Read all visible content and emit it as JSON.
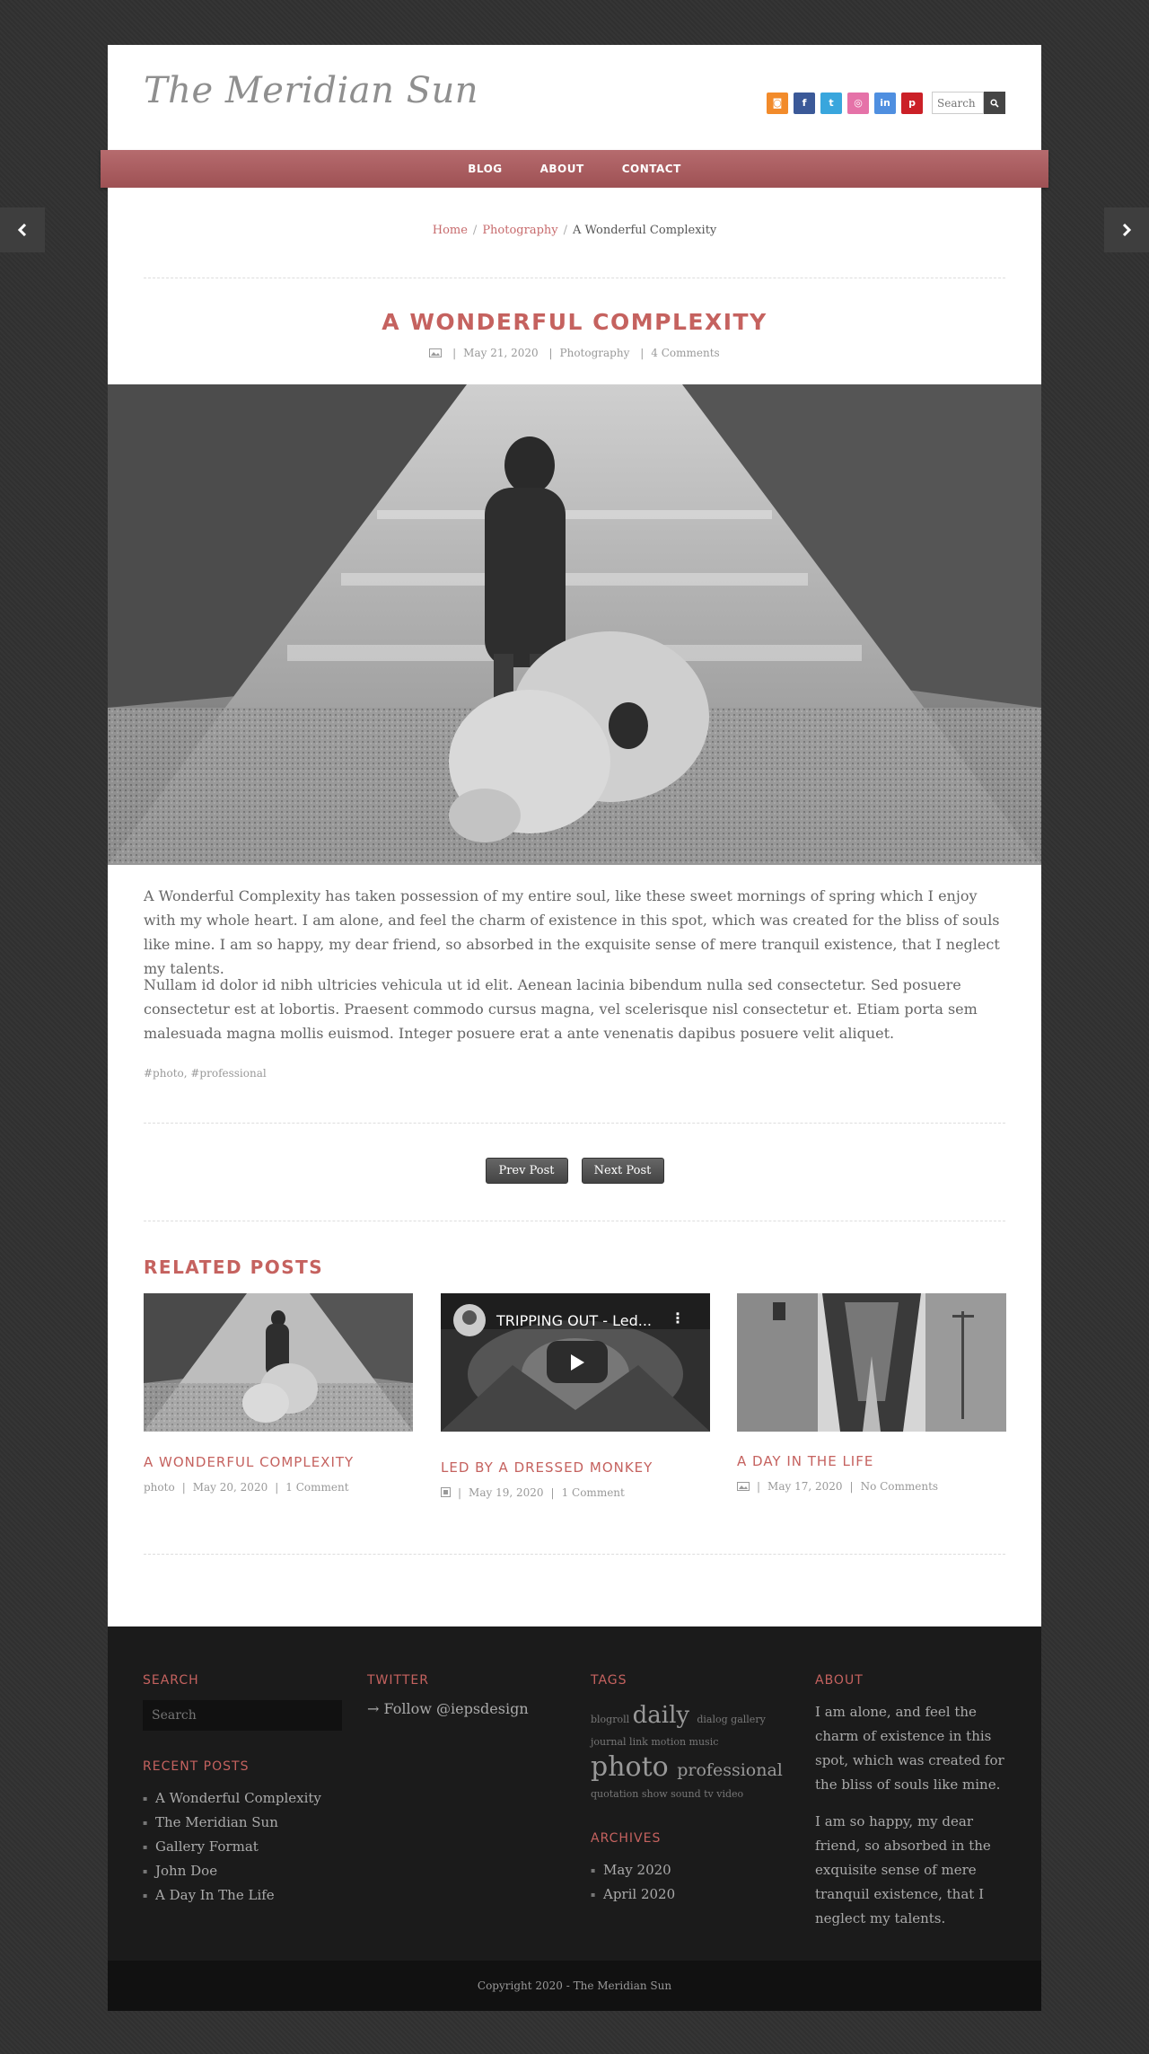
{
  "site": {
    "title": "The Meridian Sun",
    "search_placeholder": "Search"
  },
  "social": [
    {
      "name": "rss",
      "glyph": "◙",
      "color": "#f28b2b"
    },
    {
      "name": "facebook",
      "glyph": "f",
      "color": "#3b5998"
    },
    {
      "name": "twitter",
      "glyph": "t",
      "color": "#39a6dd"
    },
    {
      "name": "dribbble",
      "glyph": "◎",
      "color": "#e572a8"
    },
    {
      "name": "linkedin",
      "glyph": "in",
      "color": "#4f8fe0"
    },
    {
      "name": "pinterest",
      "glyph": "p",
      "color": "#cb2027"
    }
  ],
  "nav": [
    "BLOG",
    "ABOUT",
    "CONTACT"
  ],
  "breadcrumb": {
    "home": "Home",
    "category": "Photography",
    "current": "A Wonderful Complexity"
  },
  "post": {
    "title": "A WONDERFUL COMPLEXITY",
    "date": "May 21, 2020",
    "category": "Photography",
    "comments": "4 Comments",
    "para1": "A Wonderful Complexity has taken possession of my entire soul, like these sweet mornings of spring which I enjoy with my whole heart. I am alone, and feel the charm of existence in this spot, which was created for the bliss of souls like mine. I am so happy, my dear friend, so absorbed in the exquisite sense of mere tranquil existence, that I neglect my talents.",
    "para2": "Nullam id dolor id nibh ultricies vehicula ut id elit. Aenean lacinia bibendum nulla sed consectetur. Sed posuere consectetur est at lobortis. Praesent commodo cursus magna, vel scelerisque nisl consectetur et. Etiam porta sem malesuada magna mollis euismod. Integer posuere erat a ante venenatis dapibus posuere velit aliquet.",
    "tags": "#photo, #professional"
  },
  "buttons": {
    "prev": "Prev Post",
    "next": "Next Post"
  },
  "related": {
    "heading": "RELATED POSTS",
    "items": [
      {
        "title": "A WONDERFUL COMPLEXITY",
        "format": "photo",
        "date": "May 20, 2020",
        "comments": "1 Comment"
      },
      {
        "title": "LED BY A DRESSED MONKEY",
        "video_title": "TRIPPING OUT - Led...",
        "date": "May 19, 2020",
        "comments": "1 Comment"
      },
      {
        "title": "A DAY IN THE LIFE",
        "date": "May 17, 2020",
        "comments": "No Comments"
      }
    ]
  },
  "footer": {
    "search_heading": "SEARCH",
    "search_placeholder": "Search",
    "recent_heading": "RECENT POSTS",
    "recent": [
      "A Wonderful Complexity",
      "The Meridian Sun",
      "Gallery Format",
      "John Doe",
      "A Day In The Life"
    ],
    "twitter_heading": "TWITTER",
    "twitter_follow": "→ Follow @iepsdesign",
    "tags_heading": "TAGS",
    "tags": [
      {
        "t": "blogroll",
        "s": 11
      },
      {
        "t": "daily",
        "s": 26
      },
      {
        "t": "dialog",
        "s": 11
      },
      {
        "t": "gallery",
        "s": 11
      },
      {
        "t": "journal",
        "s": 11
      },
      {
        "t": "link",
        "s": 11
      },
      {
        "t": "motion",
        "s": 11
      },
      {
        "t": "music",
        "s": 11
      },
      {
        "t": "photo",
        "s": 30
      },
      {
        "t": "professional",
        "s": 19
      },
      {
        "t": "quotation",
        "s": 11
      },
      {
        "t": "show",
        "s": 11
      },
      {
        "t": "sound",
        "s": 11
      },
      {
        "t": "tv",
        "s": 11
      },
      {
        "t": "video",
        "s": 11
      }
    ],
    "archives_heading": "ARCHIVES",
    "archives": [
      "May 2020",
      "April 2020"
    ],
    "about_heading": "ABOUT",
    "about_p1": "I am alone, and feel the charm of existence in this spot, which was created for the bliss of souls like mine.",
    "about_p2": "I am so happy, my dear friend, so absorbed in the exquisite sense of mere tranquil existence, that I neglect my talents.",
    "copyright": "Copyright 2020 - The Meridian Sun"
  }
}
